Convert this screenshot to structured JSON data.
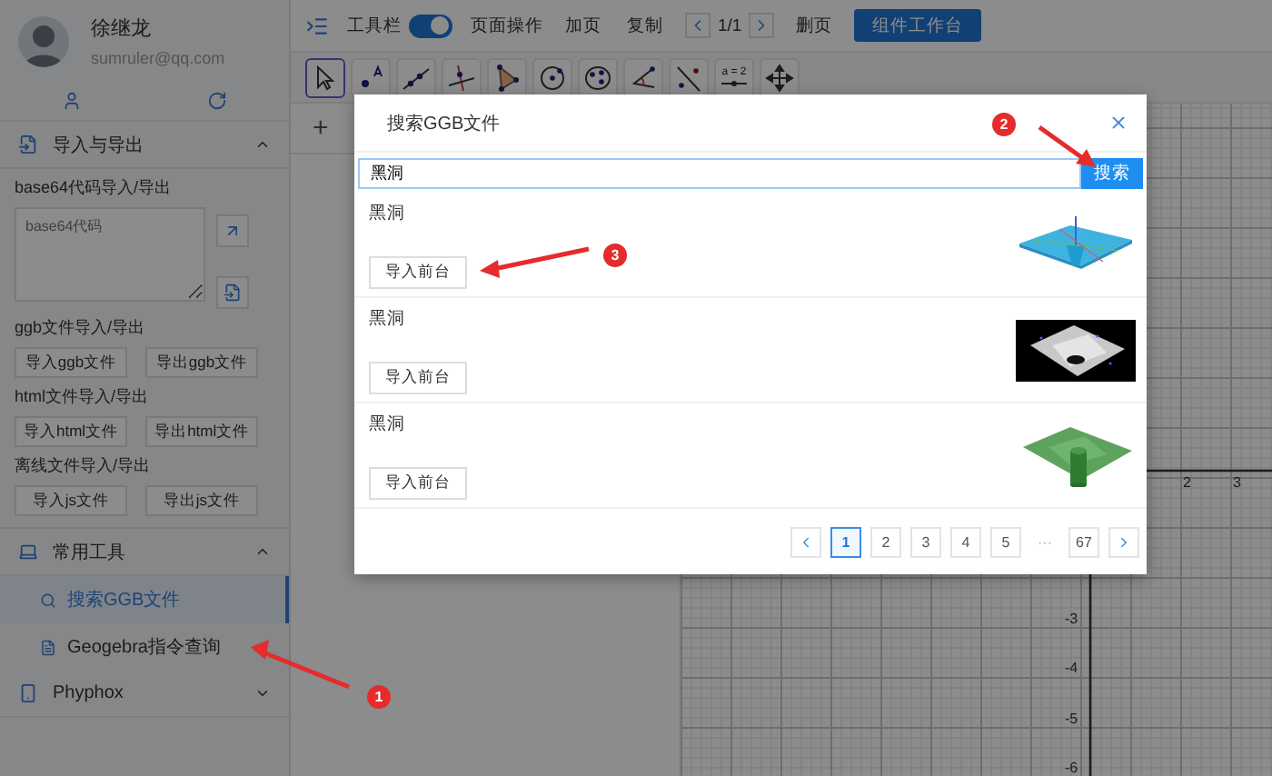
{
  "sidebar": {
    "user": {
      "name": "徐继龙",
      "email": "sumruler@qq.com"
    },
    "sections": [
      {
        "kind": "import_export",
        "title": "导入与导出",
        "expanded": true,
        "base64_label": "base64代码导入/导出",
        "base64_field": {
          "placeholder": "base64代码"
        },
        "groups": [
          {
            "label": "ggb文件导入/导出",
            "buttons": [
              "导入ggb文件",
              "导出ggb文件"
            ]
          },
          {
            "label": "html文件导入/导出",
            "buttons": [
              "导入html文件",
              "导出html文件"
            ]
          },
          {
            "label": "离线文件导入/导出",
            "buttons": [
              "导入js文件",
              "导出js文件"
            ]
          }
        ]
      },
      {
        "kind": "tools",
        "title": "常用工具",
        "expanded": true,
        "items": [
          {
            "label": "搜索GGB文件",
            "selected": true,
            "kind": "search"
          },
          {
            "label": "Geogebra指令查询",
            "selected": false,
            "kind": "doc"
          }
        ]
      },
      {
        "kind": "phyphox",
        "title": "Phyphox",
        "expanded": false
      }
    ]
  },
  "topbar": {
    "toolbar_label": "工具栏",
    "toolbar_on": true,
    "page_ops": "页面操作",
    "add_page": "加页",
    "copy": "复制",
    "page_indicator": "1/1",
    "delete_page": "删页",
    "workbench_button": "组件工作台"
  },
  "tools": [
    {
      "kind": "move",
      "selected": true
    },
    {
      "kind": "point",
      "selected": false
    },
    {
      "kind": "line",
      "selected": false
    },
    {
      "kind": "perpendicular",
      "selected": false
    },
    {
      "kind": "polygon",
      "selected": false
    },
    {
      "kind": "circle",
      "selected": false
    },
    {
      "kind": "conic",
      "selected": false
    },
    {
      "kind": "angle",
      "selected": false
    },
    {
      "kind": "reflect",
      "selected": false
    },
    {
      "kind": "slider",
      "label": "a = 2",
      "selected": false
    },
    {
      "kind": "move_view",
      "selected": false
    }
  ],
  "algebra": {
    "add_symbol": "+"
  },
  "graph": {
    "x_labels": [
      "2",
      "3"
    ],
    "y_labels": [
      "-3",
      "-4",
      "-5",
      "-6"
    ]
  },
  "dialog": {
    "title": "搜索GGB文件",
    "search": {
      "value": "黑洞"
    },
    "search_button": "搜索",
    "results": [
      {
        "title": "黑洞",
        "button": "导入前台"
      },
      {
        "title": "黑洞",
        "button": "导入前台"
      },
      {
        "title": "黑洞",
        "button": "导入前台"
      }
    ],
    "pages": [
      {
        "label": "1",
        "kind": "page",
        "selected": true
      },
      {
        "label": "2",
        "kind": "page",
        "selected": false
      },
      {
        "label": "3",
        "kind": "page",
        "selected": false
      },
      {
        "label": "4",
        "kind": "page",
        "selected": false
      },
      {
        "label": "5",
        "kind": "page",
        "selected": false
      },
      {
        "label": "···",
        "kind": "ellipsis"
      },
      {
        "label": "67",
        "kind": "page",
        "selected": false
      }
    ]
  },
  "annotations": [
    {
      "label": "1"
    },
    {
      "label": "2"
    },
    {
      "label": "3"
    }
  ]
}
